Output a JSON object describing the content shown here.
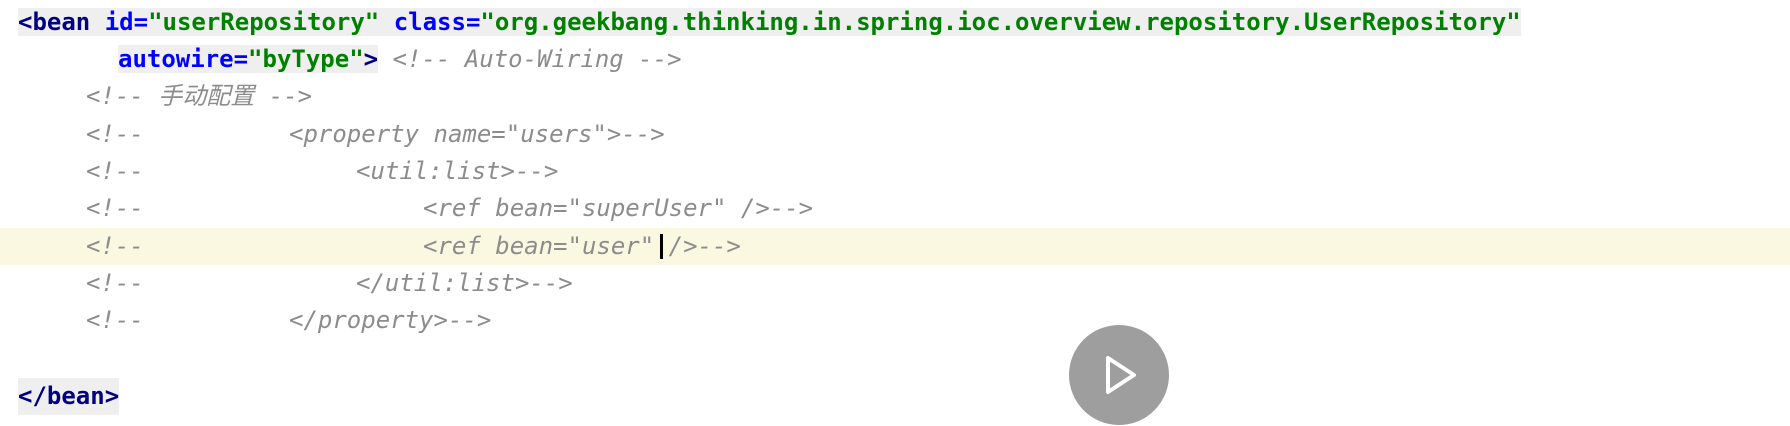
{
  "editor": {
    "lines": [
      {
        "tag_open": "<bean ",
        "attr1": "id=",
        "val1": "\"userRepository\"",
        "attr2": " class=",
        "val2": "\"org.geekbang.thinking.in.spring.ioc.overview.repository.UserRepository\""
      },
      {
        "attr": "autowire=",
        "val": "\"byType\"",
        "tag_close": ">",
        "comment": "<!-- Auto-Wiring -->"
      },
      {
        "comment": "<!-- 手动配置 -->"
      },
      {
        "prefix": "<!--",
        "code": "<property name=\"users\">-->"
      },
      {
        "prefix": "<!--",
        "code": "<util:list>-->"
      },
      {
        "prefix": "<!--",
        "code": "<ref bean=\"superUser\" />-->"
      },
      {
        "prefix": "<!--",
        "code": "<ref bean=\"user\" />-->"
      },
      {
        "prefix": "<!--",
        "code": "</util:list>-->"
      },
      {
        "prefix": "<!--",
        "code": "</property>-->"
      },
      {
        "text": ""
      },
      {
        "tag": "</bean>"
      }
    ]
  },
  "colors": {
    "tag": "#000080",
    "attribute": "#0000ff",
    "value": "#008000",
    "comment": "#8c8c8c",
    "current_line": "#fbf8e2"
  },
  "overlay": {
    "play_icon": "play-icon"
  }
}
